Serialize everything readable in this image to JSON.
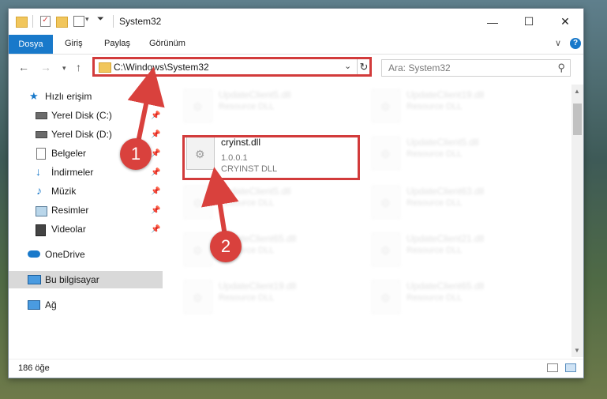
{
  "window": {
    "title": "System32",
    "minimize": "—",
    "maximize": "☐",
    "close": "✕"
  },
  "ribbon": {
    "tabs": [
      "Dosya",
      "Giriş",
      "Paylaş",
      "Görünüm"
    ],
    "expand": "∨"
  },
  "address": {
    "path": "C:\\Windows\\System32",
    "search_placeholder": "Ara: System32"
  },
  "nav": {
    "items": [
      {
        "label": "Hızlı erişim",
        "icon": "star-icon",
        "pinned": false
      },
      {
        "label": "Yerel Disk (C:)",
        "icon": "drive-icon",
        "pinned": true
      },
      {
        "label": "Yerel Disk (D:)",
        "icon": "drive-icon",
        "pinned": true
      },
      {
        "label": "Belgeler",
        "icon": "documents-icon",
        "pinned": true
      },
      {
        "label": "İndirmeler",
        "icon": "download-icon",
        "pinned": true
      },
      {
        "label": "Müzik",
        "icon": "music-icon",
        "pinned": true
      },
      {
        "label": "Resimler",
        "icon": "pictures-icon",
        "pinned": true
      },
      {
        "label": "Videolar",
        "icon": "videos-icon",
        "pinned": true
      },
      {
        "label": "OneDrive",
        "icon": "cloud-icon",
        "pinned": false
      },
      {
        "label": "Bu bilgisayar",
        "icon": "computer-icon",
        "pinned": false
      },
      {
        "label": "Ağ",
        "icon": "network-icon",
        "pinned": false
      }
    ]
  },
  "files": {
    "left": [
      {
        "name": "UpdateClient5.dll",
        "sub": "Resource DLL"
      },
      {
        "name": "cryinst.dll",
        "version": "1.0.0.1",
        "sub": "CRYINST DLL"
      },
      {
        "name": "UpdateClient5.dll",
        "sub": "Resource DLL"
      },
      {
        "name": "UpdateClient65.dll",
        "sub": "Resource DLL"
      },
      {
        "name": "UpdateClient19.dll",
        "sub": "Resource DLL"
      }
    ],
    "right": [
      {
        "name": "UpdateClient19.dll",
        "sub": "Resource DLL"
      },
      {
        "name": "UpdateClient5.dll",
        "sub": "Resource DLL"
      },
      {
        "name": "UpdateClient63.dll",
        "sub": "Resource DLL"
      },
      {
        "name": "UpdateClient21.dll",
        "sub": "Resource DLL"
      },
      {
        "name": "UpdateClient65.dll",
        "sub": "Resource DLL"
      }
    ]
  },
  "status": {
    "count": "186 öğe"
  },
  "callouts": [
    "1",
    "2"
  ],
  "colors": {
    "accent": "#1979ca",
    "highlight": "#d23b3b",
    "selection": "#cce8ff"
  }
}
